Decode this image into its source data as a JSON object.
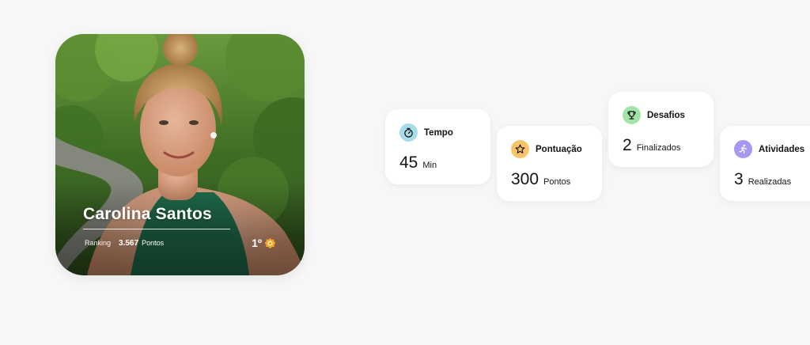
{
  "profile": {
    "name": "Carolina Santos",
    "ranking_label": "Ranking",
    "ranking_value": "3.567",
    "ranking_unit": "Pontos",
    "position": "1º",
    "medal_icon": "medal-icon"
  },
  "stats": [
    {
      "title": "Tempo",
      "value": "45",
      "unit": "Min",
      "icon": "stopwatch-icon",
      "icon_bg": "#a9dce9"
    },
    {
      "title": "Pontuação",
      "value": "300",
      "unit": "Pontos",
      "icon": "star-icon",
      "icon_bg": "#f7c46a"
    },
    {
      "title": "Desafios",
      "value": "2",
      "unit": "Finalizados",
      "icon": "trophy-icon",
      "icon_bg": "#a3e2a8"
    },
    {
      "title": "Atividades",
      "value": "3",
      "unit": "Realizadas",
      "icon": "runner-icon",
      "icon_bg": "#a697f2"
    }
  ]
}
